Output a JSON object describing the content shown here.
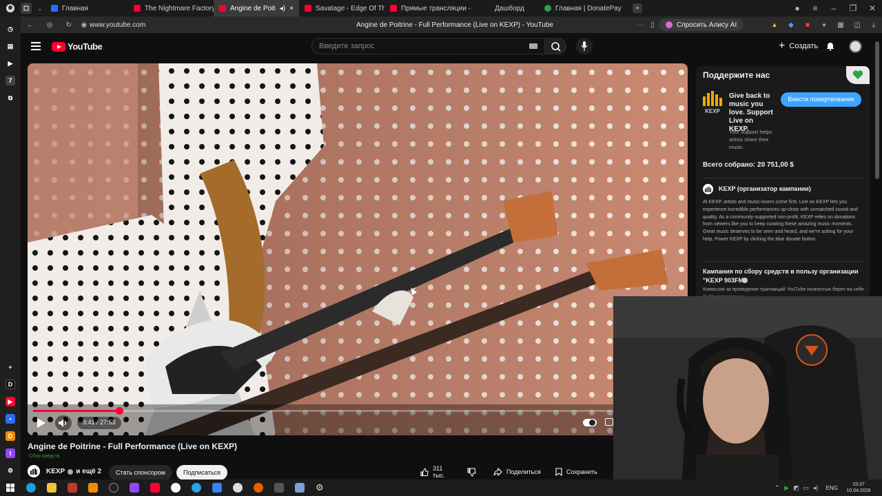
{
  "browser": {
    "tabs": [
      {
        "title": "Главная"
      },
      {
        "title": "The Nightmare Factory - Y"
      },
      {
        "title": "Angine de Poitrine - "
      },
      {
        "title": "Savatage - Edge Of Thorns"
      },
      {
        "title": "Прямые трансляции - Yo"
      },
      {
        "title": "Дашборд"
      },
      {
        "title": "Главная | DonatePay"
      }
    ],
    "url": "www.youtube.com",
    "page_title": "Angine de Poitrine - Full Performance (Live on KEXP) - YouTube",
    "alice_label": "Спросить Алису AI"
  },
  "youtube": {
    "logo_text": "YouTube",
    "search_placeholder": "Введите запрос",
    "create_label": "Создать"
  },
  "player": {
    "time": "3:41 / 27:53",
    "progress_fraction": 0.133
  },
  "video": {
    "title": "Angine de Poitrine - Full Performance (Live on KEXP)",
    "fundraiser_tag": "Сбор средств",
    "channel": "KEXP",
    "channel_extra": "и ещё 2",
    "sponsor_label": "Стать спонсором",
    "subscribe_label": "Подписаться",
    "likes": "311 тыс.",
    "share_label": "Поделиться",
    "save_label": "Сохранить"
  },
  "donate_panel": {
    "heading": "Поддержите нас",
    "logo_text": "KEXP",
    "pitch": "Give back to music you love. Support Live on KEXP.",
    "sub": "Your support helps artists share their music.",
    "donate_button": "Внести пожертвование",
    "total": "Всего собрано: 20 751,00 $",
    "org_title": "KEXP (организатор кампании)",
    "org_desc": "At KEXP, artists and music-lovers come first. Live on KEXP lets you experience incredible performances up-close with unmatched sound and quality. As a community-supported non-profit, KEXP relies on donations from viewers like you to keep curating these amazing music moments. Great music deserves to be seen and heard, and we're asking for your help. Power KEXP by clicking the blue donate button.",
    "campaign_title": "Кампания по сбору средств в пользу организации \"KEXP 903FM\"",
    "fee_note": "Комиссия за проведение транзакций YouTube полностью берет на себя.",
    "org_link": "Сайт организации"
  },
  "taskbar": {
    "lang": "ENG",
    "time": "15:37",
    "date": "10.04.2026"
  },
  "colors": {
    "yt_red": "#ff0033",
    "accent_blue": "#3ea6ff",
    "donate_green": "#2ba640"
  }
}
